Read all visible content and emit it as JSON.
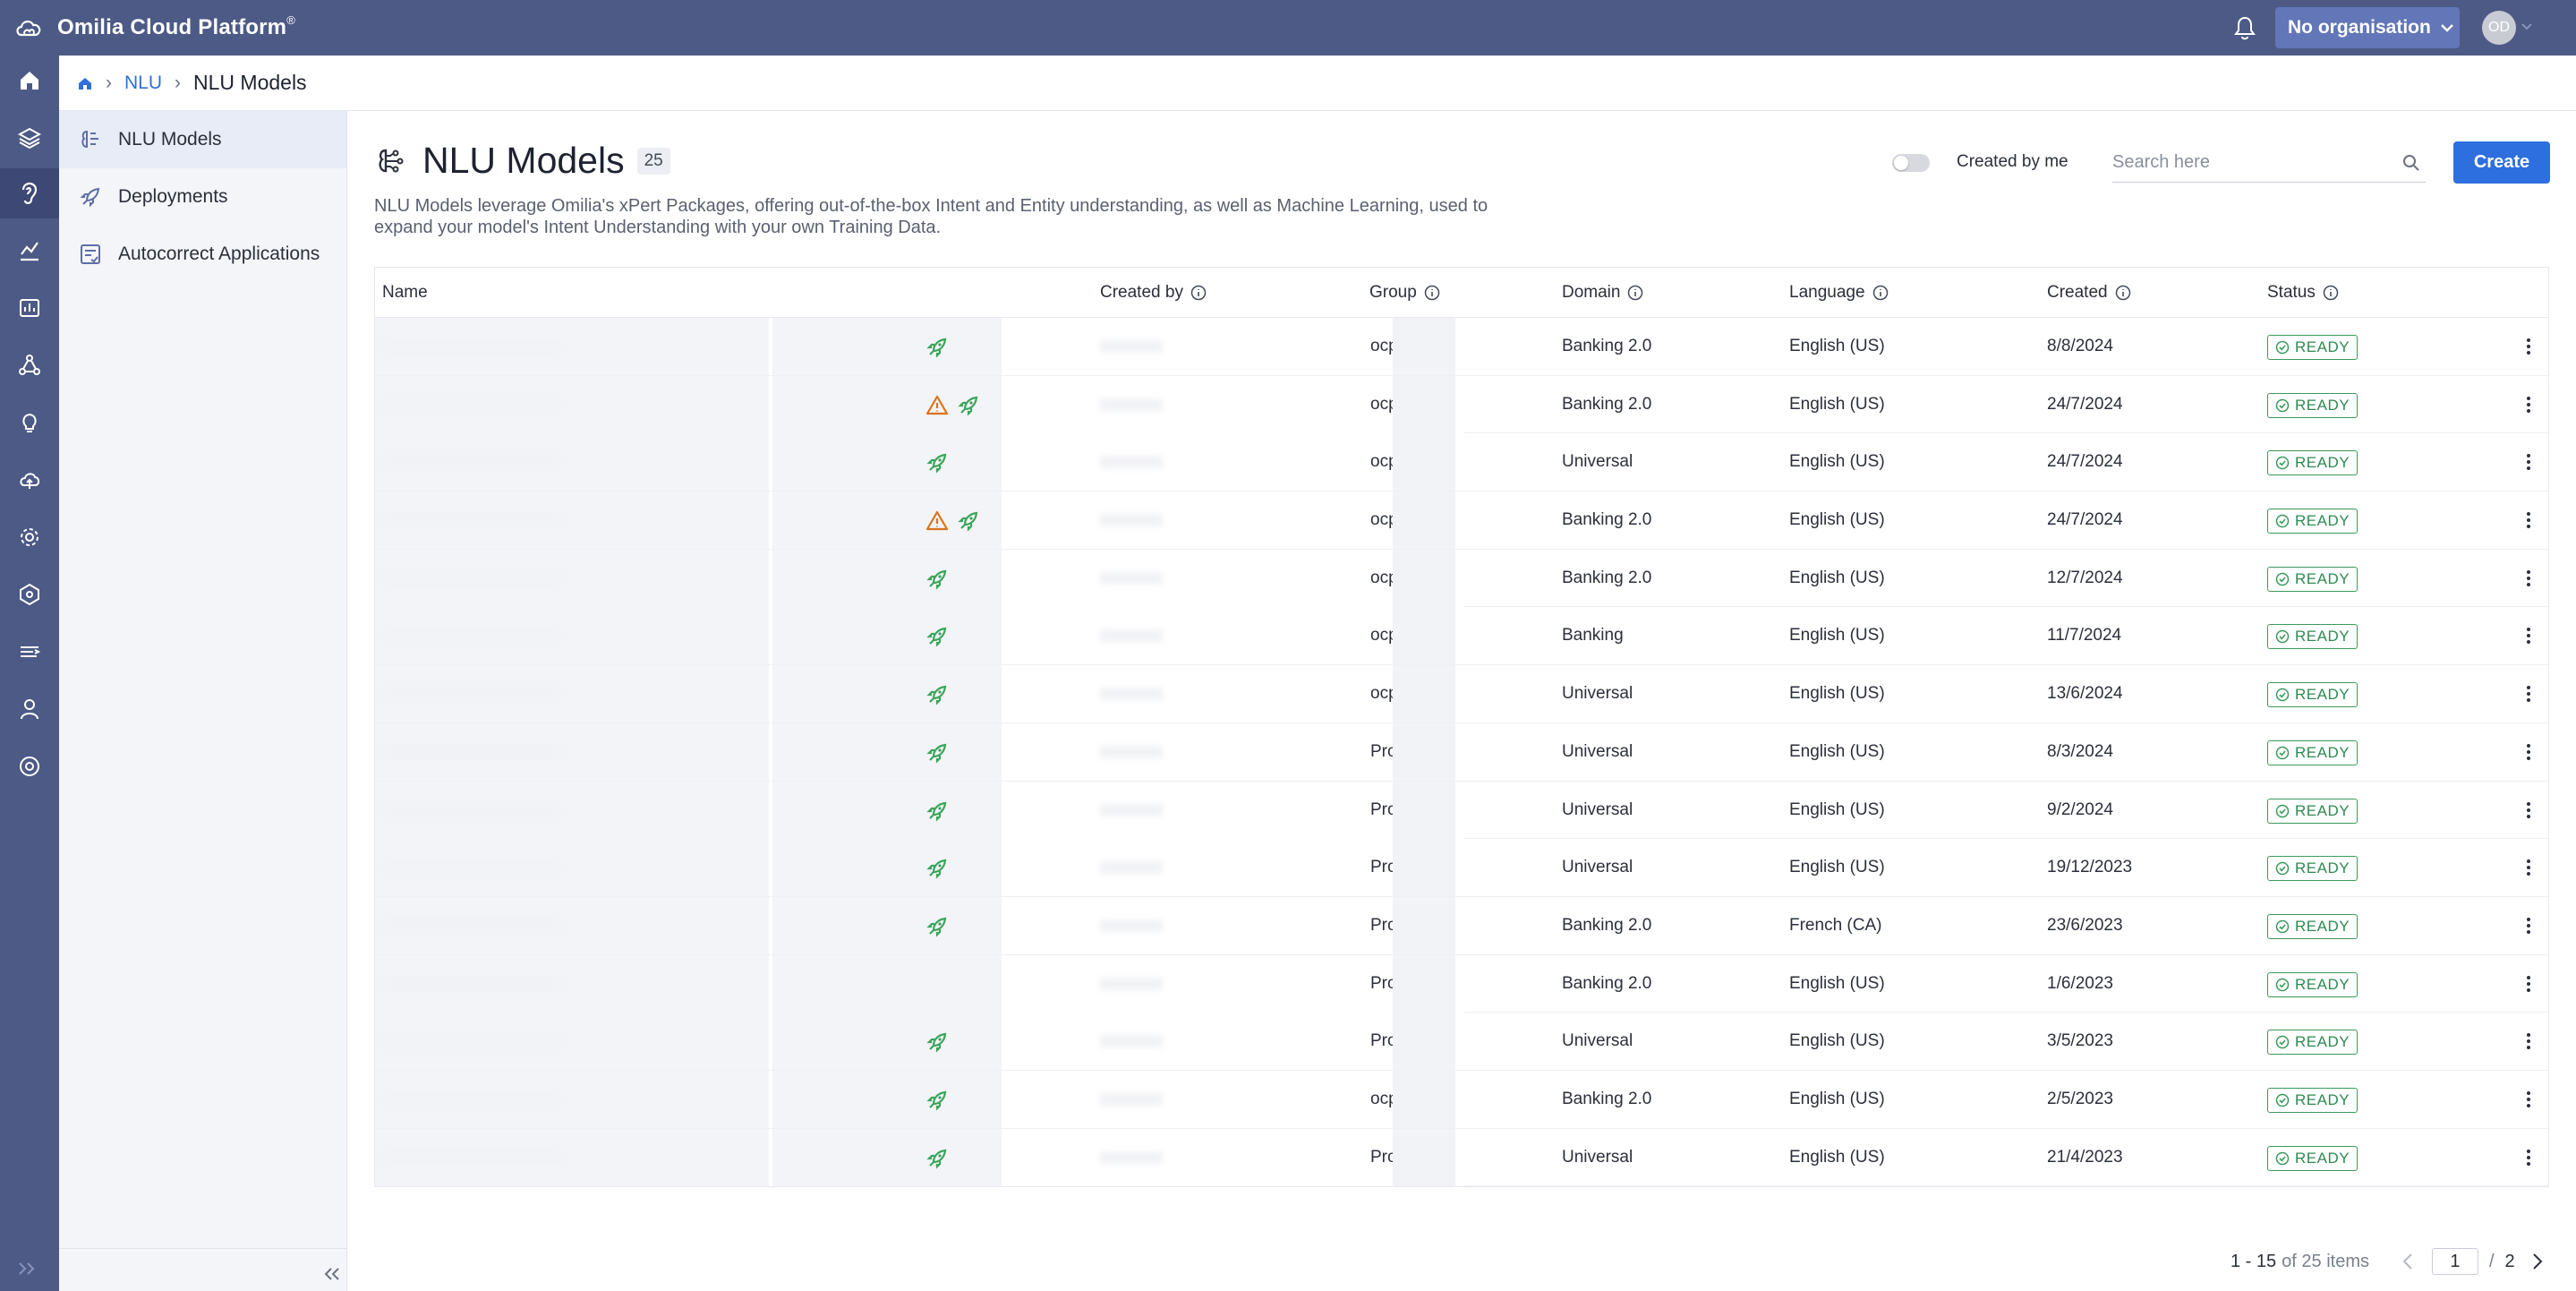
{
  "app": {
    "title": "Omilia Cloud Platform",
    "trademark": "®"
  },
  "header": {
    "org_label": "No organisation",
    "avatar_initials": "OD"
  },
  "breadcrumb": {
    "section": "NLU",
    "current": "NLU Models"
  },
  "subnav": [
    {
      "label": "NLU Models",
      "icon": "nlu-models-icon"
    },
    {
      "label": "Deployments",
      "icon": "rocket-icon"
    },
    {
      "label": "Autocorrect Applications",
      "icon": "autocorrect-icon"
    }
  ],
  "page": {
    "title": "NLU Models",
    "count": "25",
    "description": "NLU Models leverage Omilia's xPert Packages, offering out-of-the-box Intent and Entity understanding, as well as Machine Learning, used to expand your model's Intent Understanding with your own Training Data."
  },
  "filters": {
    "created_by_me_label": "Created by me",
    "created_by_me": false,
    "search_placeholder": "Search here",
    "create_label": "Create"
  },
  "table": {
    "columns": [
      "Name",
      "Created by",
      "Group",
      "Domain",
      "Language",
      "Created",
      "Status"
    ],
    "rows": [
      {
        "name": "",
        "creator": "",
        "group": "ocp",
        "domain": "Banking 2.0",
        "language": "English (US)",
        "created": "8/8/2024",
        "status": "READY",
        "warning": false,
        "deployed": true
      },
      {
        "name": "",
        "creator": "",
        "group": "ocp",
        "domain": "Banking 2.0",
        "language": "English (US)",
        "created": "24/7/2024",
        "status": "READY",
        "warning": true,
        "deployed": true
      },
      {
        "name": "",
        "creator": "",
        "group": "ocp",
        "domain": "Universal",
        "language": "English (US)",
        "created": "24/7/2024",
        "status": "READY",
        "warning": false,
        "deployed": true
      },
      {
        "name": "",
        "creator": "",
        "group": "ocp",
        "domain": "Banking 2.0",
        "language": "English (US)",
        "created": "24/7/2024",
        "status": "READY",
        "warning": true,
        "deployed": true
      },
      {
        "name": "",
        "creator": "",
        "group": "ocp",
        "domain": "Banking 2.0",
        "language": "English (US)",
        "created": "12/7/2024",
        "status": "READY",
        "warning": false,
        "deployed": true
      },
      {
        "name": "",
        "creator": "",
        "group": "ocp",
        "domain": "Banking",
        "language": "English (US)",
        "created": "11/7/2024",
        "status": "READY",
        "warning": false,
        "deployed": true
      },
      {
        "name": "",
        "creator": "",
        "group": "ocp",
        "domain": "Universal",
        "language": "English (US)",
        "created": "13/6/2024",
        "status": "READY",
        "warning": false,
        "deployed": true
      },
      {
        "name": "",
        "creator": "",
        "group": "Pro",
        "domain": "Universal",
        "language": "English (US)",
        "created": "8/3/2024",
        "status": "READY",
        "warning": false,
        "deployed": true
      },
      {
        "name": "",
        "creator": "",
        "group": "Pro",
        "domain": "Universal",
        "language": "English (US)",
        "created": "9/2/2024",
        "status": "READY",
        "warning": false,
        "deployed": true
      },
      {
        "name": "",
        "creator": "",
        "group": "Pro",
        "domain": "Universal",
        "language": "English (US)",
        "created": "19/12/2023",
        "status": "READY",
        "warning": false,
        "deployed": true
      },
      {
        "name": "",
        "creator": "",
        "group": "Pro",
        "domain": "Banking 2.0",
        "language": "French (CA)",
        "created": "23/6/2023",
        "status": "READY",
        "warning": false,
        "deployed": true
      },
      {
        "name": "",
        "creator": "",
        "group": "Pro",
        "domain": "Banking 2.0",
        "language": "English (US)",
        "created": "1/6/2023",
        "status": "READY",
        "warning": false,
        "deployed": false
      },
      {
        "name": "",
        "creator": "",
        "group": "Pro",
        "domain": "Universal",
        "language": "English (US)",
        "created": "3/5/2023",
        "status": "READY",
        "warning": false,
        "deployed": true
      },
      {
        "name": "",
        "creator": "",
        "group": "ocp",
        "domain": "Banking 2.0",
        "language": "English (US)",
        "created": "2/5/2023",
        "status": "READY",
        "warning": false,
        "deployed": true
      },
      {
        "name": "",
        "creator": "",
        "group": "Pro",
        "domain": "Universal",
        "language": "English (US)",
        "created": "21/4/2023",
        "status": "READY",
        "warning": false,
        "deployed": true
      }
    ]
  },
  "pagination": {
    "range": "1 - 15",
    "total": "of 25 items",
    "page": "1",
    "pages": "2"
  },
  "colors": {
    "topbar": "#4d5a86",
    "accent": "#2d6fdf",
    "ready": "#3a9a5b",
    "warning": "#d9731f",
    "rocket": "#3aa55a"
  }
}
